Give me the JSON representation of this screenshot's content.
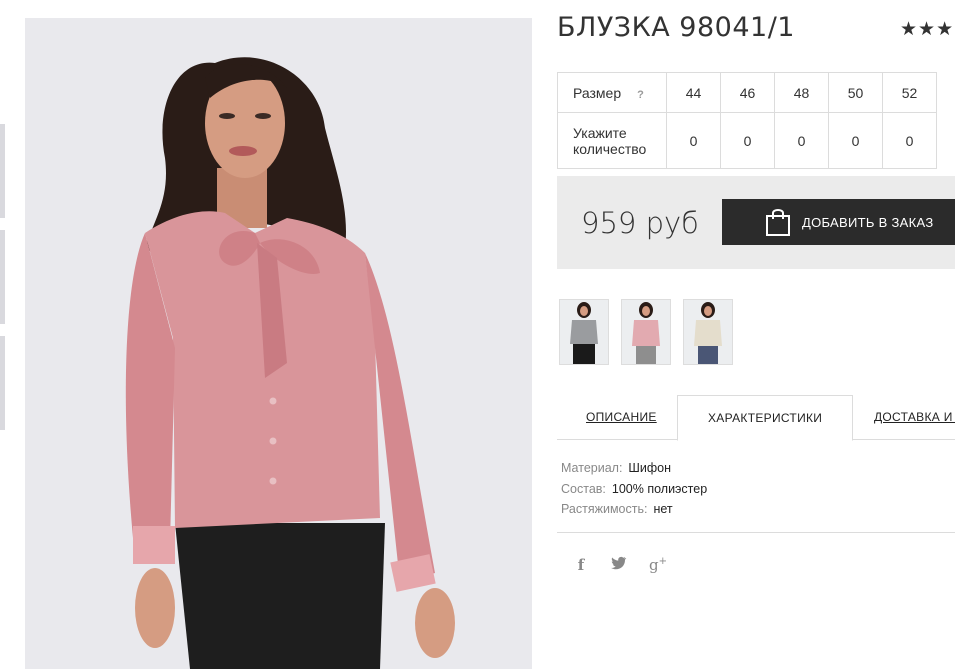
{
  "product": {
    "title": "БЛУЗКА 98041/1",
    "rating_stars": "★★★"
  },
  "size_table": {
    "size_label": "Размер",
    "help_icon": "?",
    "sizes": [
      "44",
      "46",
      "48",
      "50",
      "52"
    ],
    "qty_label": "Укажите количество",
    "quantities": [
      "0",
      "0",
      "0",
      "0",
      "0"
    ]
  },
  "buy": {
    "price": "959 руб",
    "add_button": "ДОБАВИТЬ В ЗАКАЗ",
    "button_icon": "shopping-bag-icon"
  },
  "variants": [
    {
      "name": "variant-grey"
    },
    {
      "name": "variant-pink"
    },
    {
      "name": "variant-beige"
    }
  ],
  "tabs": [
    {
      "label": "ОПИСАНИЕ",
      "active": false
    },
    {
      "label": "ХАРАКТЕРИСТИКИ",
      "active": true
    },
    {
      "label": "ДОСТАВКА И О",
      "active": false
    }
  ],
  "characteristics": [
    {
      "key": "Материал:",
      "value": "Шифон"
    },
    {
      "key": "Состав:",
      "value": "100% полиэстер"
    },
    {
      "key": "Растяжимость:",
      "value": "нет"
    }
  ],
  "social": [
    {
      "icon": "facebook-icon",
      "glyph": "f"
    },
    {
      "icon": "twitter-icon",
      "glyph": "t"
    },
    {
      "icon": "google-plus-icon",
      "glyph": "g+"
    }
  ],
  "colors": {
    "blouse": "#d9959a",
    "skirt": "#1e1e1e",
    "button_bg": "#2b2b2b",
    "buybox_bg": "#ebebeb"
  }
}
